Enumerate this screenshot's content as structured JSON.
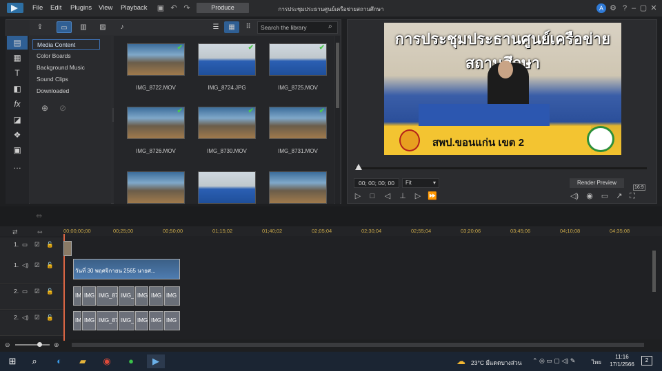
{
  "window": {
    "title": "การประชุมประธานศูนย์เครือข่ายสถานศึกษา",
    "produce_label": "Produce"
  },
  "menu": [
    "File",
    "Edit",
    "Plugins",
    "View",
    "Playback"
  ],
  "library": {
    "search_placeholder": "Search the library",
    "categories": [
      {
        "label": "Media Content",
        "selected": true
      },
      {
        "label": "Color Boards"
      },
      {
        "label": "Background Music"
      },
      {
        "label": "Sound Clips"
      },
      {
        "label": "Downloaded"
      }
    ],
    "items": [
      {
        "label": "IMG_8722.MOV",
        "style": "room"
      },
      {
        "label": "IMG_8724.JPG",
        "style": "blue"
      },
      {
        "label": "IMG_8725.MOV",
        "style": "blue"
      },
      {
        "label": "IMG_8726.MOV",
        "style": "room"
      },
      {
        "label": "IMG_8730.MOV",
        "style": "room"
      },
      {
        "label": "IMG_8731.MOV",
        "style": "room"
      },
      {
        "label": "",
        "style": "room"
      },
      {
        "label": "",
        "style": "blue"
      },
      {
        "label": "",
        "style": "room"
      }
    ]
  },
  "preview": {
    "banner_title": "การประชุมประธานศูนย์เครือข่ายสถานศึกษา",
    "banner_sub": "สพป.ขอนแก่น เขต 2",
    "timecode": "00; 00; 00; 00",
    "fit": "Fit",
    "render_label": "Render Preview",
    "aspect": "16:9"
  },
  "timeline": {
    "ruler": [
      "00;00;00;00",
      "00;25;00",
      "00;50;00",
      "01;15;02",
      "01;40;02",
      "02;05;04",
      "02;30;04",
      "02;55;04",
      "03;20;06",
      "03;45;06",
      "04;10;08",
      "04;35;08"
    ],
    "tracks": [
      {
        "label": "1."
      },
      {
        "label": "1."
      },
      {
        "label": "2."
      },
      {
        "label": "2."
      }
    ],
    "audio_clip": "วันที่ 30 พฤศจิกายน 2565 นายศ...",
    "video_clips": [
      "IMG",
      "IMG",
      "IMG_87",
      "IMG_87",
      "IMG",
      "IMG",
      "IMG",
      "IMG"
    ]
  },
  "taskbar": {
    "weather": "23°C  มีแดดบางส่วน",
    "lang": "ไทย",
    "time": "11:16",
    "date": "17/1/2566",
    "notif": "2"
  }
}
